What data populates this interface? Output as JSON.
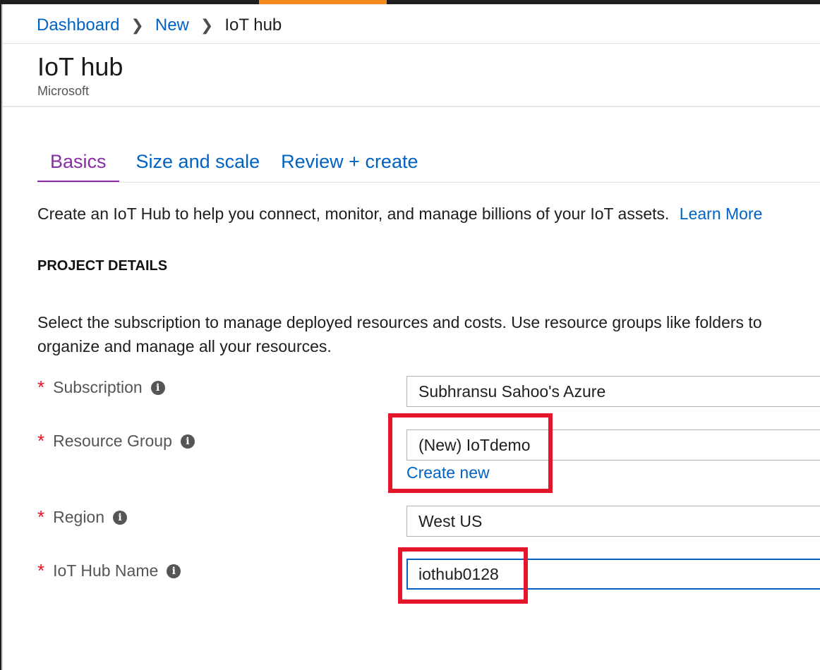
{
  "breadcrumb": {
    "items": [
      "Dashboard",
      "New"
    ],
    "current": "IoT hub",
    "separator": ">"
  },
  "header": {
    "title": "IoT hub",
    "subtitle": "Microsoft"
  },
  "tabs": [
    {
      "label": "Basics",
      "active": true
    },
    {
      "label": "Size and scale",
      "active": false
    },
    {
      "label": "Review + create",
      "active": false
    }
  ],
  "intro": {
    "text": "Create an IoT Hub to help you connect, monitor, and manage billions of your IoT assets.",
    "link": "Learn More"
  },
  "project_details": {
    "heading": "PROJECT DETAILS",
    "description": "Select the subscription to manage deployed resources and costs. Use resource groups like folders to organize and manage all your resources."
  },
  "form": {
    "subscription": {
      "label": "Subscription",
      "value": "Subhransu Sahoo's Azure"
    },
    "resource_group": {
      "label": "Resource Group",
      "value": "(New) IoTdemo",
      "create_new": "Create new"
    },
    "region": {
      "label": "Region",
      "value": "West US"
    },
    "hub_name": {
      "label": "IoT Hub Name",
      "value": "iothub0128"
    }
  },
  "colors": {
    "link": "#0063c4",
    "active_tab": "#8a2da8",
    "required": "#e81123",
    "highlight": "#e3162b",
    "top_accent": "#f48a1b"
  },
  "icons": {
    "info": "info-icon",
    "chevron": "chevron-right-icon"
  }
}
